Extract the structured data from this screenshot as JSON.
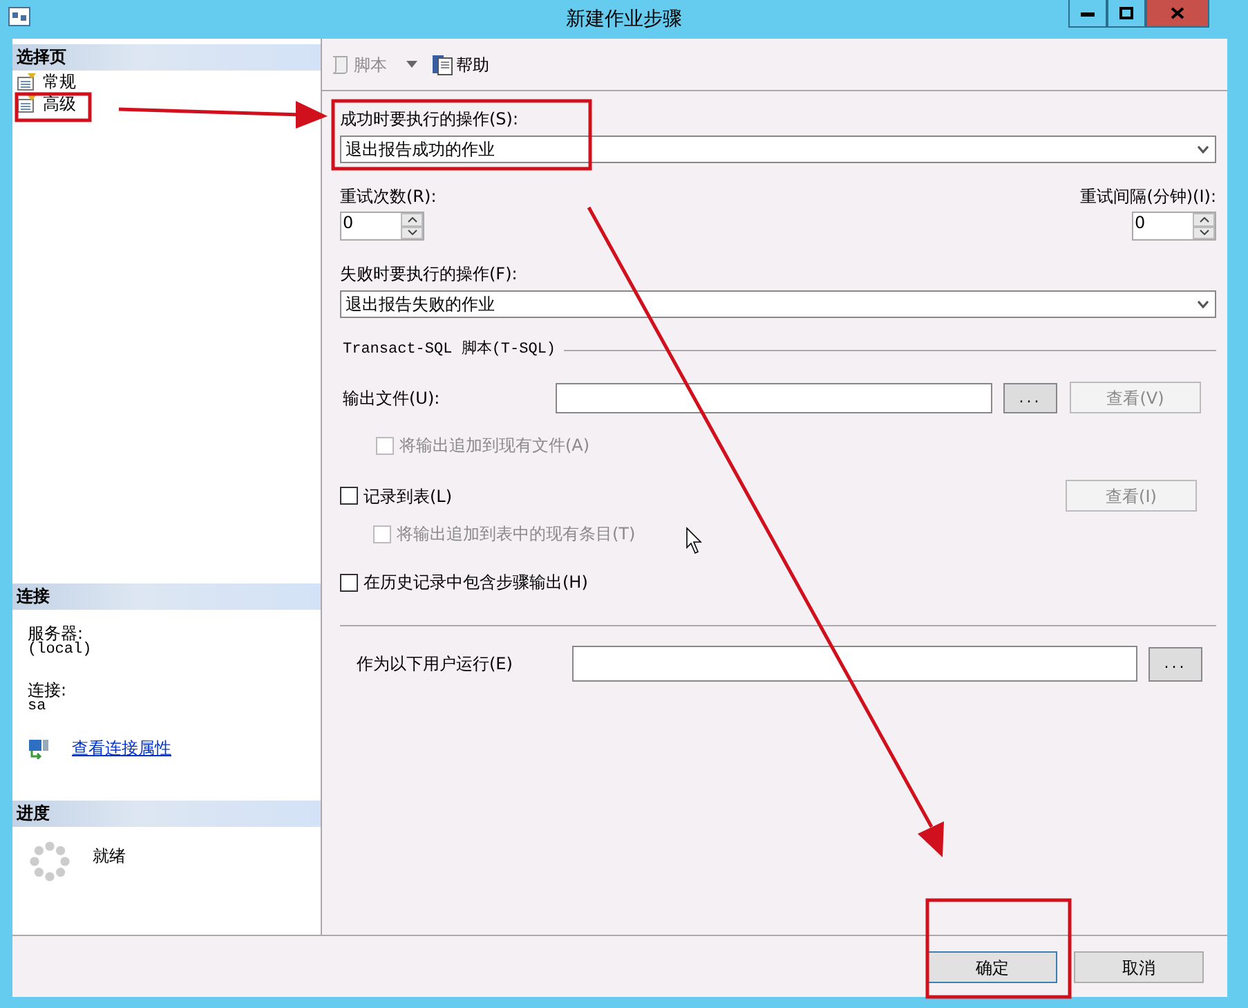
{
  "window": {
    "title": "新建作业步骤"
  },
  "select_page": {
    "title": "选择页",
    "items": [
      {
        "label": "常规"
      },
      {
        "label": "高级"
      }
    ]
  },
  "toolbar": [
    {
      "label": "脚本",
      "disabled": true,
      "dropdown": true
    },
    {
      "label": "帮助",
      "disabled": false,
      "dropdown": false
    }
  ],
  "connection": {
    "title": "连接",
    "server_label": "服务器:",
    "server": "(local)",
    "login_label": "连接:",
    "login": "sa",
    "link": "查看连接属性"
  },
  "progress": {
    "title": "进度",
    "status": "就绪"
  },
  "form": {
    "on_success": {
      "label": "成功时要执行的操作(S):",
      "value": "退出报告成功的作业"
    },
    "retry_attempts": {
      "label": "重试次数(R):",
      "value": "0"
    },
    "retry_interval": {
      "label": "重试间隔(分钟)(I):",
      "value": "0"
    },
    "on_failure": {
      "label": "失败时要执行的操作(F):",
      "value": "退出报告失败的作业"
    },
    "tsql_group": "Transact-SQL 脚本(T-SQL)",
    "output_file": {
      "label": "输出文件(U):",
      "browse": "...",
      "view": {
        "label": "查看(V)",
        "disabled": true
      }
    },
    "append_to_file": {
      "label": "将输出追加到现有文件(A)",
      "checked": false,
      "disabled": true
    },
    "log_to_table": {
      "label": "记录到表(L)",
      "checked": false,
      "disabled": false
    },
    "view_table": {
      "label": "查看(I)",
      "disabled": true
    },
    "append_to_table": {
      "label": "将输出追加到表中的现有条目(T)",
      "checked": false,
      "disabled": true
    },
    "include_history": {
      "label": "在历史记录中包含步骤输出(H)",
      "checked": false,
      "disabled": false
    },
    "run_as": {
      "label": "作为以下用户运行(E)",
      "browse": "..."
    }
  },
  "buttons": [
    {
      "label": "确定",
      "default": true
    },
    {
      "label": "取消",
      "default": false
    }
  ]
}
